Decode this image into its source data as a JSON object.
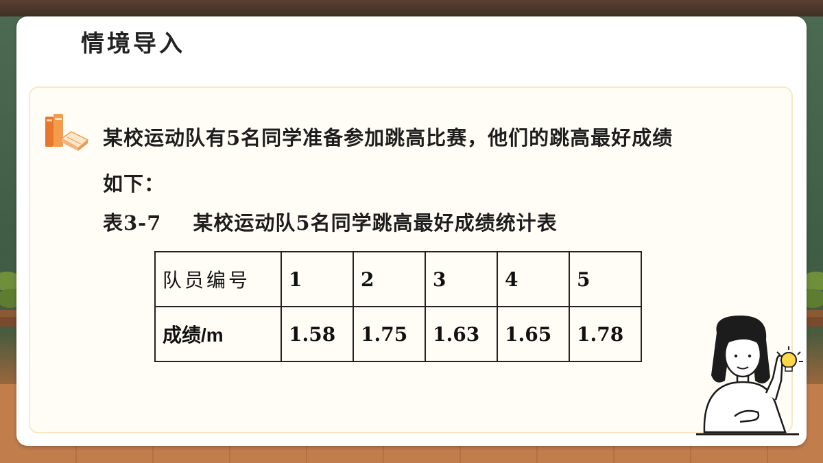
{
  "slide": {
    "title": "情境导入",
    "paragraph_line1": "某校运动队有5名同学准备参加跳高比赛，他们的跳高最好成绩",
    "paragraph_line2": "如下：",
    "caption_number": "表3-7",
    "caption_text": "某校运动队5名同学跳高最好成绩统计表"
  },
  "table": {
    "row_headers": [
      "队员编号",
      "成绩/m"
    ],
    "ids": [
      "1",
      "2",
      "3",
      "4",
      "5"
    ],
    "scores": [
      "1.58",
      "1.75",
      "1.63",
      "1.65",
      "1.78"
    ]
  },
  "icons": {
    "book": "book-stack-icon",
    "teacher": "teacher-illustration",
    "bulb": "lightbulb-icon"
  },
  "colors": {
    "card_bg": "#ffffff",
    "inner_bg": "#fffdf6",
    "inner_border": "#f6e9c4",
    "text": "#1d1d1d",
    "book_accent": "#e8772e"
  }
}
